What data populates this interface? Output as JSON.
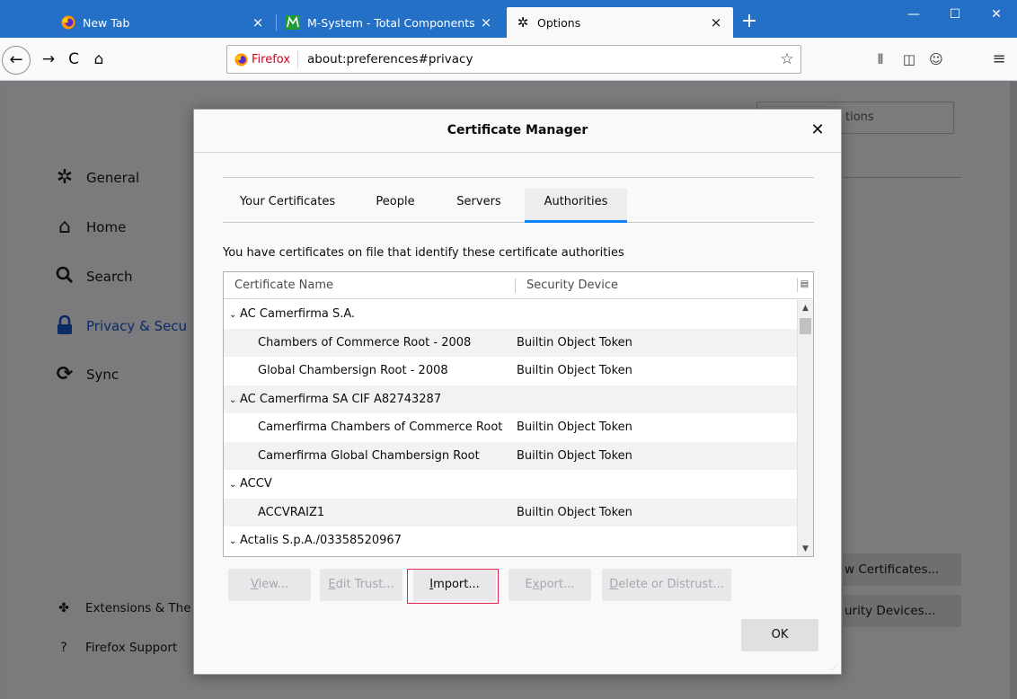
{
  "browser": {
    "tabs": [
      {
        "title": "New Tab",
        "close": "×"
      },
      {
        "title": "M-System - Total Components",
        "close": "×"
      },
      {
        "title": "Options",
        "close": "×"
      }
    ],
    "new_tab": "+",
    "window_controls": {
      "minimize": "—",
      "maximize": "☐",
      "close": "✕"
    },
    "nav": {
      "back": "←",
      "forward": "→",
      "reload": "C",
      "home": "⌂"
    },
    "urlbar": {
      "identity": "Firefox",
      "url": "about:preferences#privacy",
      "bookmark": "☆"
    },
    "toolbar_icons": {
      "library": "⫴",
      "sidebar": "◫",
      "account": "☺",
      "menu": "≡"
    }
  },
  "preferences": {
    "sidebar": [
      {
        "label": "General",
        "icon": "gear-icon"
      },
      {
        "label": "Home",
        "icon": "home-icon"
      },
      {
        "label": "Search",
        "icon": "search-icon"
      },
      {
        "label": "Privacy & Secu",
        "icon": "lock-icon",
        "active": true
      },
      {
        "label": "Sync",
        "icon": "sync-icon"
      }
    ],
    "footer": [
      {
        "label": "Extensions & The",
        "icon": "puzzle-icon"
      },
      {
        "label": "Firefox Support",
        "icon": "help-icon"
      }
    ],
    "find_placeholder_visible": "tions",
    "background_buttons": [
      "w Certificates...",
      "urity Devices..."
    ]
  },
  "dialog": {
    "title": "Certificate Manager",
    "close": "✕",
    "tabs": [
      {
        "label": "Your Certificates",
        "active": false
      },
      {
        "label": "People",
        "active": false
      },
      {
        "label": "Servers",
        "active": false
      },
      {
        "label": "Authorities",
        "active": true
      }
    ],
    "intro": "You have certificates on file that identify these certificate authorities",
    "columns": {
      "name": "Certificate Name",
      "device": "Security Device"
    },
    "rows": [
      {
        "type": "group",
        "name": "AC Camerfirma S.A.",
        "device": ""
      },
      {
        "type": "child",
        "name": "Chambers of Commerce Root - 2008",
        "device": "Builtin Object Token"
      },
      {
        "type": "child",
        "name": "Global Chambersign Root - 2008",
        "device": "Builtin Object Token"
      },
      {
        "type": "group",
        "name": "AC Camerfirma SA CIF A82743287",
        "device": ""
      },
      {
        "type": "child",
        "name": "Camerfirma Chambers of Commerce Root",
        "device": "Builtin Object Token"
      },
      {
        "type": "child",
        "name": "Camerfirma Global Chambersign Root",
        "device": "Builtin Object Token"
      },
      {
        "type": "group",
        "name": "ACCV",
        "device": ""
      },
      {
        "type": "child",
        "name": "ACCVRAIZ1",
        "device": "Builtin Object Token"
      },
      {
        "type": "group",
        "name": "Actalis S.p.A./03358520967",
        "device": ""
      }
    ],
    "buttons": {
      "view": {
        "pre": "",
        "key": "V",
        "post": "iew..."
      },
      "edit_trust": {
        "pre": "",
        "key": "E",
        "post": "dit Trust..."
      },
      "import": {
        "pre": "",
        "key": "I",
        "post": "mport..."
      },
      "export": {
        "pre": "E",
        "key": "x",
        "post": "port..."
      },
      "delete": {
        "pre": "",
        "key": "D",
        "post": "elete or Distrust..."
      },
      "ok": "OK"
    }
  },
  "colors": {
    "accent": "#0a84ff",
    "titlebar": "#2570c7",
    "highlight": "#e22850"
  }
}
